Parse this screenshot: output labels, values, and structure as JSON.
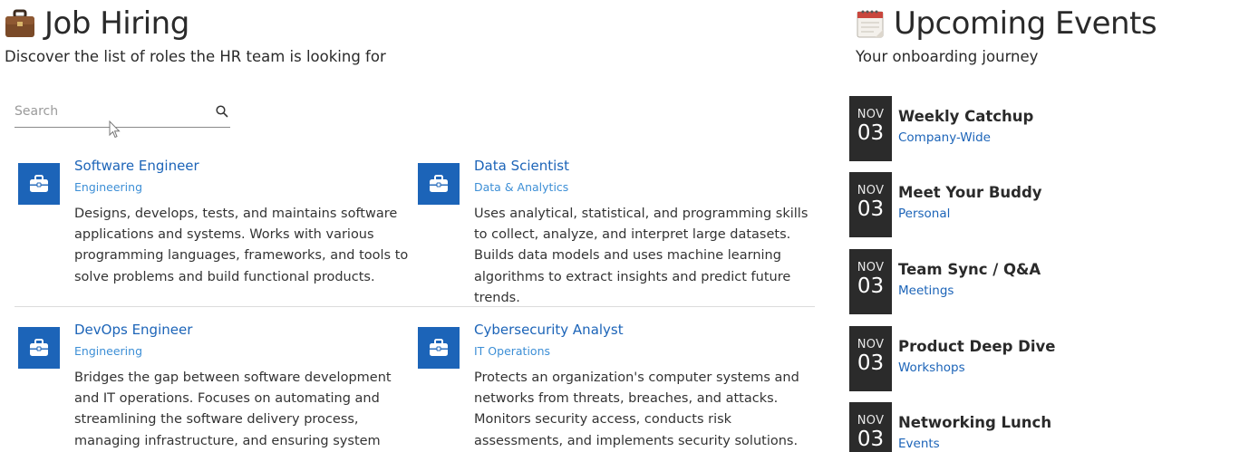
{
  "jobs_section": {
    "title": "Job Hiring",
    "title_icon": "briefcase-emoji",
    "subtitle": "Discover the list of roles the HR team is looking for",
    "search": {
      "placeholder": "Search",
      "value": ""
    },
    "jobs": [
      {
        "title": "Software Engineer",
        "department": "Engineering",
        "description": "Designs, develops, tests, and maintains software applications and systems. Works with various programming languages, frameworks, and tools to solve problems and build functional products."
      },
      {
        "title": "Data Scientist",
        "department": "Data & Analytics",
        "description": "Uses analytical, statistical, and programming skills to collect, analyze, and interpret large datasets. Builds data models and uses machine learning algorithms to extract insights and predict future trends."
      },
      {
        "title": "DevOps Engineer",
        "department": "Engineering",
        "description": "Bridges the gap between software development and IT operations. Focuses on automating and streamlining the software delivery process, managing infrastructure, and ensuring system stability and performance."
      },
      {
        "title": "Cybersecurity Analyst",
        "department": "IT Operations",
        "description": "Protects an organization's computer systems and networks from threats, breaches, and attacks. Monitors security access, conducts risk assessments, and implements security solutions."
      }
    ]
  },
  "events_section": {
    "title": "Upcoming Events",
    "title_icon": "calendar-emoji",
    "subtitle": "Your onboarding journey",
    "events": [
      {
        "month": "NOV",
        "day": "03",
        "name": "Weekly Catchup",
        "category": "Company-Wide"
      },
      {
        "month": "NOV",
        "day": "03",
        "name": "Meet Your Buddy",
        "category": "Personal"
      },
      {
        "month": "NOV",
        "day": "03",
        "name": "Team Sync / Q&A",
        "category": "Meetings"
      },
      {
        "month": "NOV",
        "day": "03",
        "name": "Product Deep Dive",
        "category": "Workshops"
      },
      {
        "month": "NOV",
        "day": "03",
        "name": "Networking Lunch",
        "category": "Events"
      }
    ]
  },
  "colors": {
    "accent": "#1c64b8",
    "department_text": "#3d8fd6",
    "date_block": "#2b2b2b"
  }
}
